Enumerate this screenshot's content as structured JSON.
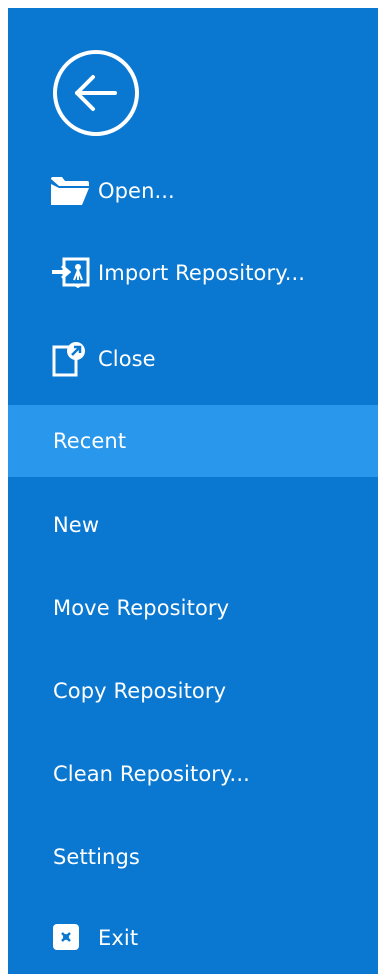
{
  "menu": {
    "back": {
      "icon": "back-arrow-icon"
    },
    "items": [
      {
        "label": "Open...",
        "icon": "folder-open-icon"
      },
      {
        "label": "Import Repository...",
        "icon": "import-repository-icon"
      },
      {
        "label": "Close",
        "icon": "close-document-icon"
      },
      {
        "label": "Recent",
        "selected": true
      },
      {
        "label": "New"
      },
      {
        "label": "Move Repository"
      },
      {
        "label": "Copy Repository"
      },
      {
        "label": "Clean Repository..."
      },
      {
        "label": "Settings"
      },
      {
        "label": "Exit",
        "icon": "exit-icon"
      }
    ]
  },
  "colors": {
    "panel_background": "#0a78d1",
    "selected_background": "#2997ec",
    "text": "#ffffff"
  }
}
